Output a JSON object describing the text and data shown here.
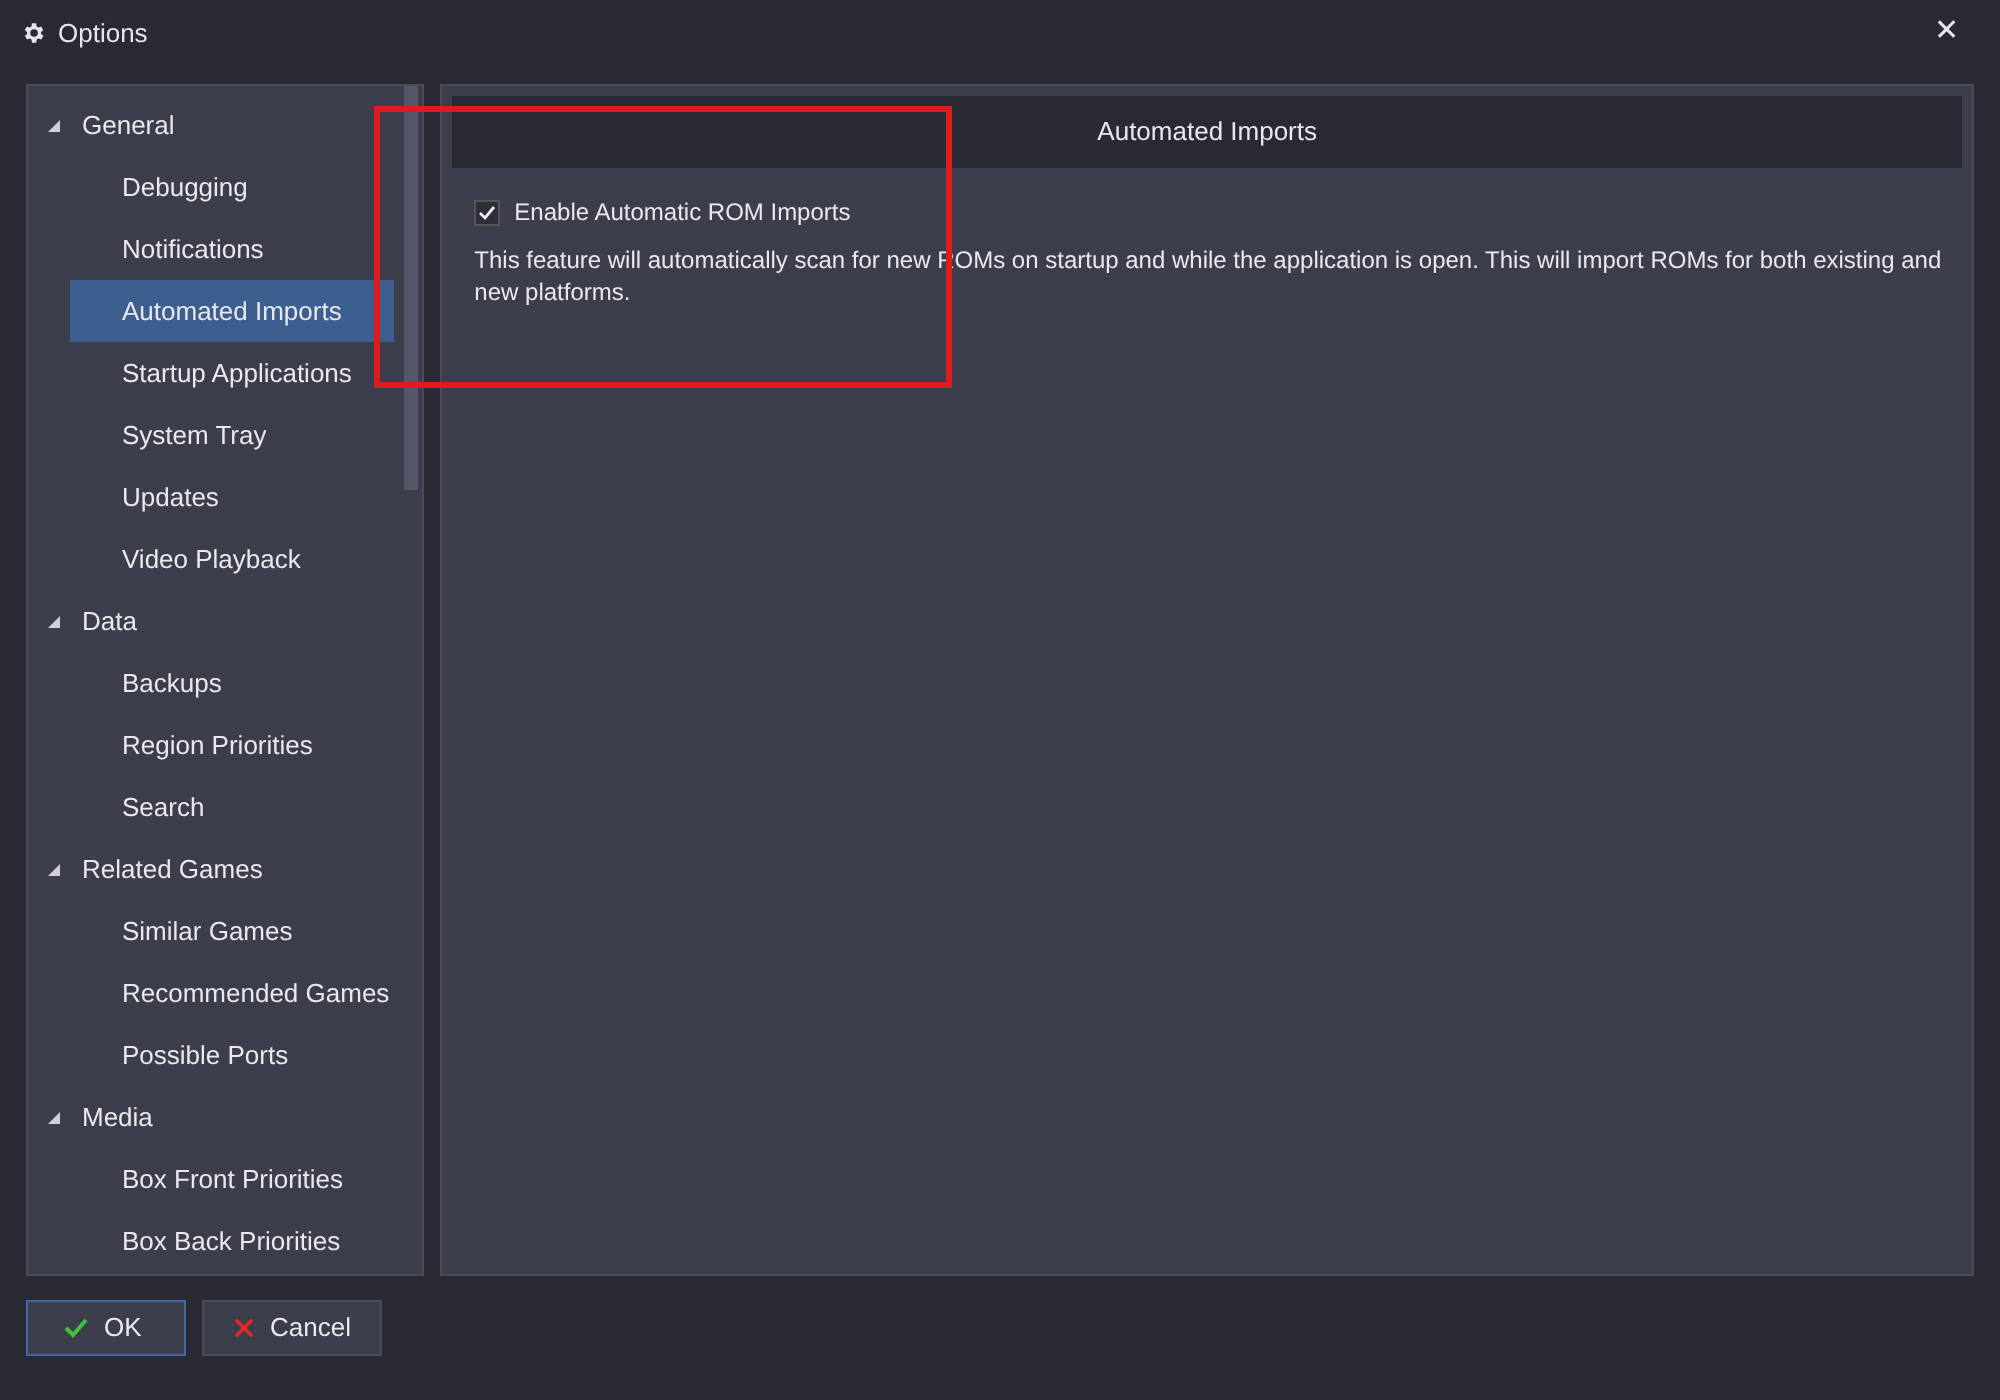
{
  "window": {
    "title": "Options",
    "close_label": "✕"
  },
  "tree": [
    {
      "label": "General",
      "expanded": true,
      "selected": false,
      "children": [
        {
          "label": "Debugging",
          "selected": false
        },
        {
          "label": "Notifications",
          "selected": false
        },
        {
          "label": "Automated Imports",
          "selected": true
        },
        {
          "label": "Startup Applications",
          "selected": false
        },
        {
          "label": "System Tray",
          "selected": false
        },
        {
          "label": "Updates",
          "selected": false
        },
        {
          "label": "Video Playback",
          "selected": false
        }
      ]
    },
    {
      "label": "Data",
      "expanded": true,
      "selected": false,
      "children": [
        {
          "label": "Backups",
          "selected": false
        },
        {
          "label": "Region Priorities",
          "selected": false
        },
        {
          "label": "Search",
          "selected": false
        }
      ]
    },
    {
      "label": "Related Games",
      "expanded": true,
      "selected": false,
      "children": [
        {
          "label": "Similar Games",
          "selected": false
        },
        {
          "label": "Recommended Games",
          "selected": false
        },
        {
          "label": "Possible Ports",
          "selected": false
        }
      ]
    },
    {
      "label": "Media",
      "expanded": true,
      "selected": false,
      "children": [
        {
          "label": "Box Front Priorities",
          "selected": false
        },
        {
          "label": "Box Back Priorities",
          "selected": false
        }
      ]
    }
  ],
  "panel": {
    "header": "Automated Imports",
    "checkbox": {
      "label": "Enable Automatic ROM Imports",
      "checked": true
    },
    "description": "This feature will automatically scan for new ROMs on startup and while the application is open. This will import ROMs for both existing and new platforms."
  },
  "buttons": [
    {
      "label": "OK",
      "kind": "ok"
    },
    {
      "label": "Cancel",
      "kind": "cancel"
    }
  ]
}
